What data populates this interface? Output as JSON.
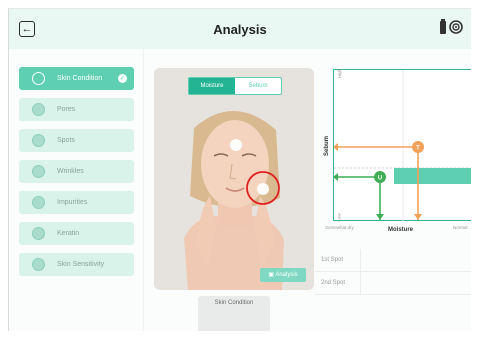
{
  "header": {
    "title": "Analysis",
    "back_icon": "arrow-left-icon",
    "status_icons": [
      "battery-icon",
      "wifi-icon"
    ]
  },
  "sidebar": {
    "items": [
      {
        "label": "Skin Condition",
        "icon": "face-icon",
        "active": true
      },
      {
        "label": "Pores",
        "icon": "pores-icon",
        "active": false
      },
      {
        "label": "Spots",
        "icon": "spots-icon",
        "active": false
      },
      {
        "label": "Wrinkles",
        "icon": "wrinkles-icon",
        "active": false
      },
      {
        "label": "Impurities",
        "icon": "impurities-icon",
        "active": false
      },
      {
        "label": "Keratin",
        "icon": "keratin-icon",
        "active": false
      },
      {
        "label": "Skin Sensitivity",
        "icon": "sensitivity-icon",
        "active": false
      }
    ]
  },
  "photo": {
    "toggle": [
      {
        "label": "Moisture",
        "selected": true
      },
      {
        "label": "Sebum",
        "selected": false
      }
    ],
    "analysis_button": "Analysis"
  },
  "condition_card": {
    "title": "Skin Condition"
  },
  "chart": {
    "y_label": "Sebum",
    "x_label": "Moisture",
    "y_ticks": [
      "High",
      "Low"
    ],
    "x_ticks": [
      "Somewhat dry",
      "Normal"
    ],
    "markers": [
      "T",
      "U"
    ],
    "colors": {
      "accent": "#5fcfb1",
      "orange": "#f2a15b",
      "green": "#3fae57"
    }
  },
  "spots": {
    "rows": [
      "1st Spot",
      "2nd Spot"
    ]
  }
}
